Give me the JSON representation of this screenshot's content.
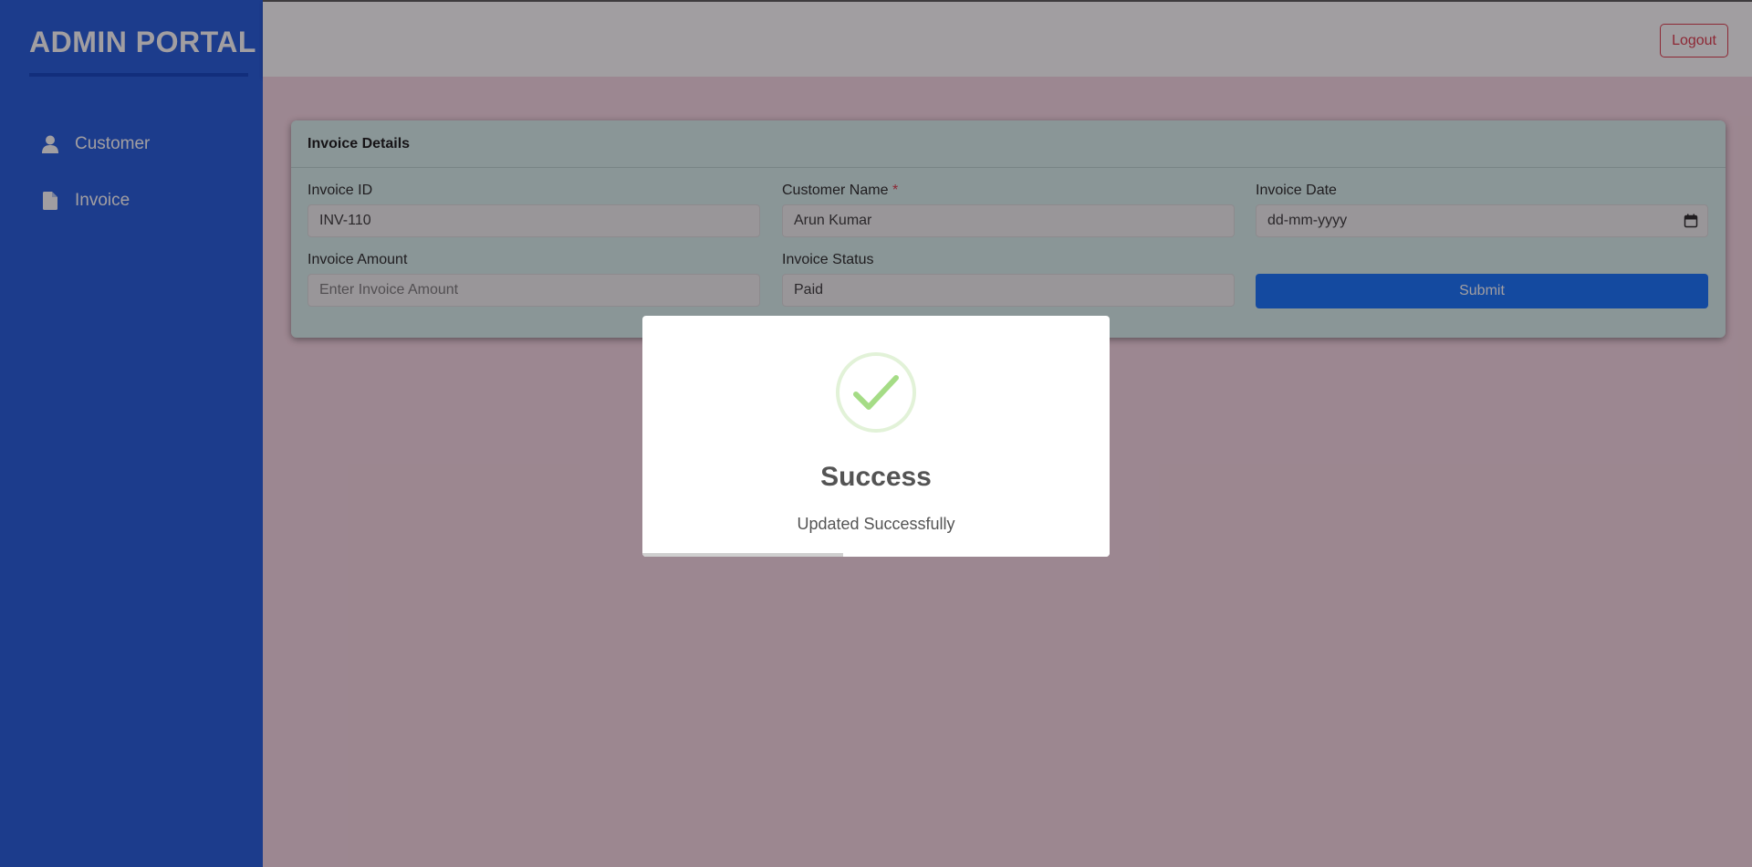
{
  "sidebar": {
    "brand": "ADMIN PORTAL",
    "items": [
      {
        "label": "Customer",
        "icon": "user-icon"
      },
      {
        "label": "Invoice",
        "icon": "file-icon"
      }
    ]
  },
  "topbar": {
    "logout_label": "Logout"
  },
  "card": {
    "title": "Invoice Details",
    "fields": {
      "invoice_id": {
        "label": "Invoice ID",
        "value": "INV-110"
      },
      "customer_name": {
        "label": "Customer Name",
        "required_mark": "*",
        "value": "Arun Kumar"
      },
      "invoice_date": {
        "label": "Invoice Date",
        "placeholder": "dd-mm-yyyy"
      },
      "invoice_amount": {
        "label": "Invoice Amount",
        "placeholder": "Enter Invoice Amount"
      },
      "invoice_status": {
        "label": "Invoice Status",
        "value": "Paid"
      }
    },
    "submit_label": "Submit"
  },
  "modal": {
    "icon": "success-check-icon",
    "title": "Success",
    "message": "Updated Successfully",
    "timer_progress": 0.43
  },
  "colors": {
    "sidebar": "#1a56db",
    "primary": "#0d6efd",
    "danger": "#dc3545",
    "success_check": "#a5dc86",
    "main_bg": "#f7d7e3",
    "card_bg": "#d7f2ee"
  }
}
